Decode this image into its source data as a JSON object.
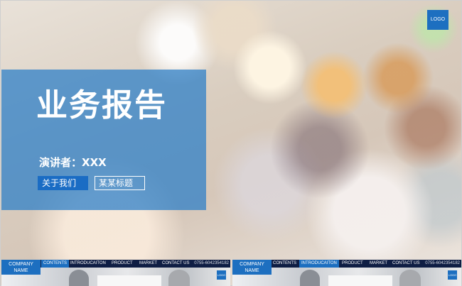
{
  "slide": {
    "logo": "LOGO",
    "title": "业务报告",
    "presenter": "演讲者：XXX",
    "button_about": "关于我们",
    "button_title": "某某标题"
  },
  "thumbnails": [
    {
      "company": "COMPANY NAME",
      "nav": [
        "CONTENTS",
        "INTRODUCAITON",
        "PRODUCT",
        "MARKET",
        "CONTACT US"
      ],
      "active": "CONTENTS",
      "phone": "0755-6042354182",
      "logo": "LOGO"
    },
    {
      "company": "COMPANY NAME",
      "nav": [
        "CONTENTS",
        "INTRODUCAITON",
        "PRODUCT",
        "MARKET",
        "CONTACT US"
      ],
      "active": "INTRODUCAITON",
      "phone": "0755-6042354182",
      "logo": "LOGO"
    }
  ],
  "colors": {
    "accent": "#1d6fc0",
    "panel": "#287dc8",
    "nav_bar": "#0f1e44"
  }
}
